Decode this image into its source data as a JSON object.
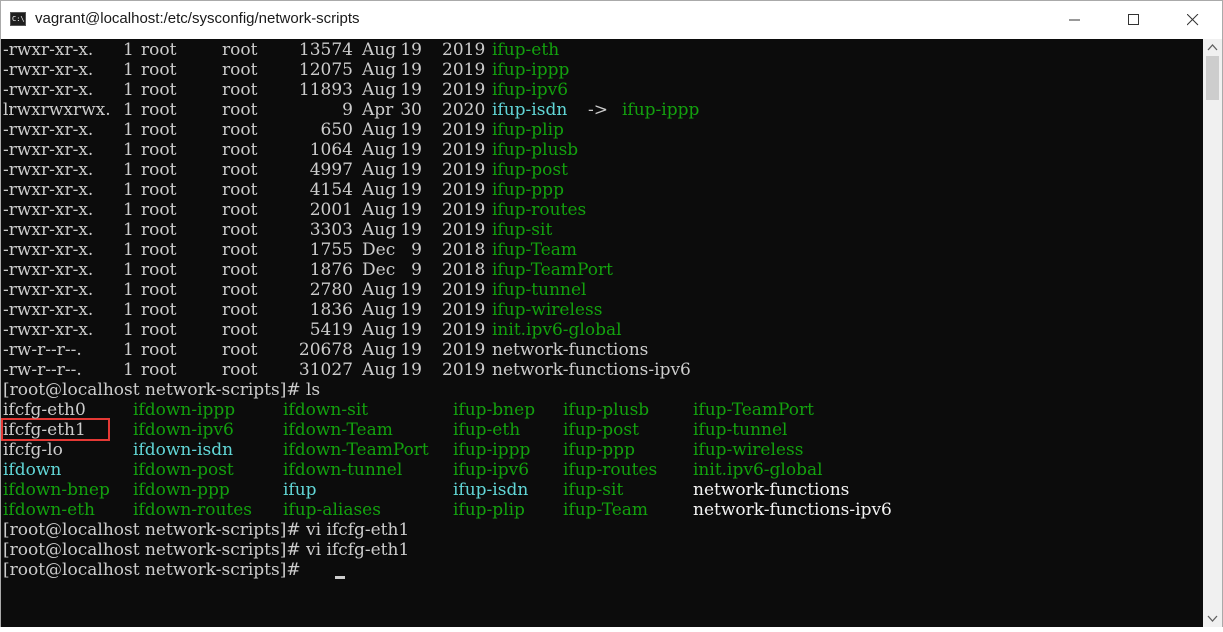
{
  "window": {
    "title": "vagrant@localhost:/etc/sysconfig/network-scripts",
    "icon": "cmd-icon",
    "icon_text": "C:\\"
  },
  "terminal": {
    "listing": [
      {
        "perm": "-rwxr-xr-x.",
        "links": "1",
        "owner": "root",
        "group": "root",
        "size": "13574",
        "mon": "Aug",
        "day": "19",
        "year": "2019",
        "name": "ifup-eth",
        "color": "green"
      },
      {
        "perm": "-rwxr-xr-x.",
        "links": "1",
        "owner": "root",
        "group": "root",
        "size": "12075",
        "mon": "Aug",
        "day": "19",
        "year": "2019",
        "name": "ifup-ippp",
        "color": "green"
      },
      {
        "perm": "-rwxr-xr-x.",
        "links": "1",
        "owner": "root",
        "group": "root",
        "size": "11893",
        "mon": "Aug",
        "day": "19",
        "year": "2019",
        "name": "ifup-ipv6",
        "color": "green"
      },
      {
        "perm": "lrwxrwxrwx.",
        "links": "1",
        "owner": "root",
        "group": "root",
        "size": "9",
        "mon": "Apr",
        "day": "30",
        "year": "2020",
        "name": "ifup-isdn",
        "color": "cyan",
        "arrow": "->",
        "target": "ifup-ippp"
      },
      {
        "perm": "-rwxr-xr-x.",
        "links": "1",
        "owner": "root",
        "group": "root",
        "size": "650",
        "mon": "Aug",
        "day": "19",
        "year": "2019",
        "name": "ifup-plip",
        "color": "green"
      },
      {
        "perm": "-rwxr-xr-x.",
        "links": "1",
        "owner": "root",
        "group": "root",
        "size": "1064",
        "mon": "Aug",
        "day": "19",
        "year": "2019",
        "name": "ifup-plusb",
        "color": "green"
      },
      {
        "perm": "-rwxr-xr-x.",
        "links": "1",
        "owner": "root",
        "group": "root",
        "size": "4997",
        "mon": "Aug",
        "day": "19",
        "year": "2019",
        "name": "ifup-post",
        "color": "green"
      },
      {
        "perm": "-rwxr-xr-x.",
        "links": "1",
        "owner": "root",
        "group": "root",
        "size": "4154",
        "mon": "Aug",
        "day": "19",
        "year": "2019",
        "name": "ifup-ppp",
        "color": "green"
      },
      {
        "perm": "-rwxr-xr-x.",
        "links": "1",
        "owner": "root",
        "group": "root",
        "size": "2001",
        "mon": "Aug",
        "day": "19",
        "year": "2019",
        "name": "ifup-routes",
        "color": "green"
      },
      {
        "perm": "-rwxr-xr-x.",
        "links": "1",
        "owner": "root",
        "group": "root",
        "size": "3303",
        "mon": "Aug",
        "day": "19",
        "year": "2019",
        "name": "ifup-sit",
        "color": "green"
      },
      {
        "perm": "-rwxr-xr-x.",
        "links": "1",
        "owner": "root",
        "group": "root",
        "size": "1755",
        "mon": "Dec",
        "day": "9",
        "year": "2018",
        "name": "ifup-Team",
        "color": "green"
      },
      {
        "perm": "-rwxr-xr-x.",
        "links": "1",
        "owner": "root",
        "group": "root",
        "size": "1876",
        "mon": "Dec",
        "day": "9",
        "year": "2018",
        "name": "ifup-TeamPort",
        "color": "green"
      },
      {
        "perm": "-rwxr-xr-x.",
        "links": "1",
        "owner": "root",
        "group": "root",
        "size": "2780",
        "mon": "Aug",
        "day": "19",
        "year": "2019",
        "name": "ifup-tunnel",
        "color": "green"
      },
      {
        "perm": "-rwxr-xr-x.",
        "links": "1",
        "owner": "root",
        "group": "root",
        "size": "1836",
        "mon": "Aug",
        "day": "19",
        "year": "2019",
        "name": "ifup-wireless",
        "color": "green"
      },
      {
        "perm": "-rwxr-xr-x.",
        "links": "1",
        "owner": "root",
        "group": "root",
        "size": "5419",
        "mon": "Aug",
        "day": "19",
        "year": "2019",
        "name": "init.ipv6-global",
        "color": "green"
      },
      {
        "perm": "-rw-r--r--.",
        "links": "1",
        "owner": "root",
        "group": "root",
        "size": "20678",
        "mon": "Aug",
        "day": "19",
        "year": "2019",
        "name": "network-functions",
        "color": "gray"
      },
      {
        "perm": "-rw-r--r--.",
        "links": "1",
        "owner": "root",
        "group": "root",
        "size": "31027",
        "mon": "Aug",
        "day": "19",
        "year": "2019",
        "name": "network-functions-ipv6",
        "color": "gray"
      }
    ],
    "ls_command": "[root@localhost network-scripts]# ls",
    "ls_columns": [
      [
        {
          "name": "ifcfg-eth0",
          "color": "gray"
        },
        {
          "name": "ifcfg-eth1",
          "color": "gray"
        },
        {
          "name": "ifcfg-lo",
          "color": "gray"
        },
        {
          "name": "ifdown",
          "color": "cyan"
        },
        {
          "name": "ifdown-bnep",
          "color": "green"
        },
        {
          "name": "ifdown-eth",
          "color": "green"
        }
      ],
      [
        {
          "name": "ifdown-ippp",
          "color": "green"
        },
        {
          "name": "ifdown-ipv6",
          "color": "green"
        },
        {
          "name": "ifdown-isdn",
          "color": "cyan"
        },
        {
          "name": "ifdown-post",
          "color": "green"
        },
        {
          "name": "ifdown-ppp",
          "color": "green"
        },
        {
          "name": "ifdown-routes",
          "color": "green"
        }
      ],
      [
        {
          "name": "ifdown-sit",
          "color": "green"
        },
        {
          "name": "ifdown-Team",
          "color": "green"
        },
        {
          "name": "ifdown-TeamPort",
          "color": "green"
        },
        {
          "name": "ifdown-tunnel",
          "color": "green"
        },
        {
          "name": "ifup",
          "color": "cyan"
        },
        {
          "name": "ifup-aliases",
          "color": "green"
        }
      ],
      [
        {
          "name": "ifup-bnep",
          "color": "green"
        },
        {
          "name": "ifup-eth",
          "color": "green"
        },
        {
          "name": "ifup-ippp",
          "color": "green"
        },
        {
          "name": "ifup-ipv6",
          "color": "green"
        },
        {
          "name": "ifup-isdn",
          "color": "cyan"
        },
        {
          "name": "ifup-plip",
          "color": "green"
        }
      ],
      [
        {
          "name": "ifup-plusb",
          "color": "green"
        },
        {
          "name": "ifup-post",
          "color": "green"
        },
        {
          "name": "ifup-ppp",
          "color": "green"
        },
        {
          "name": "ifup-routes",
          "color": "green"
        },
        {
          "name": "ifup-sit",
          "color": "green"
        },
        {
          "name": "ifup-Team",
          "color": "green"
        }
      ],
      [
        {
          "name": "ifup-TeamPort",
          "color": "green"
        },
        {
          "name": "ifup-tunnel",
          "color": "green"
        },
        {
          "name": "ifup-wireless",
          "color": "green"
        },
        {
          "name": "init.ipv6-global",
          "color": "green"
        },
        {
          "name": "network-functions",
          "color": "white"
        },
        {
          "name": "network-functions-ipv6",
          "color": "white"
        }
      ]
    ],
    "history": [
      "[root@localhost network-scripts]# vi ifcfg-eth1",
      "[root@localhost network-scripts]# vi ifcfg-eth1",
      "[root@localhost network-scripts]# "
    ],
    "highlighted_item": "ifcfg-eth1",
    "colors": {
      "background": "#0c0c0c",
      "text": "#cccccc",
      "executable": "#13a10e",
      "symlink": "#61d6d6",
      "highlight_border": "#e53935"
    }
  }
}
